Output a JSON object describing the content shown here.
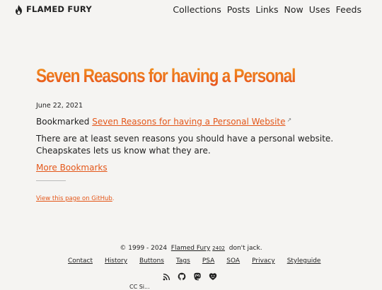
{
  "brand": {
    "name": "FLAMED FURY",
    "logo_icon": "flame-icon"
  },
  "nav": {
    "items": [
      {
        "label": "Collections"
      },
      {
        "label": "Posts"
      },
      {
        "label": "Links"
      },
      {
        "label": "Now"
      },
      {
        "label": "Uses"
      },
      {
        "label": "Feeds"
      }
    ]
  },
  "post": {
    "title": "Seven Reasons for having a Personal Website",
    "date": "June 22, 2021",
    "bookmarked_prefix": "Bookmarked",
    "bookmark_link": "Seven Reasons for having a Personal Website",
    "external_icon": "external-link-icon",
    "description": "There are at least seven reasons you should have a personal website. Cheapskates lets us know what they are.",
    "more_link": "More Bookmarks",
    "github_link": "View this page on GitHub",
    "github_suffix": "."
  },
  "footer": {
    "copyright": "© 1999 - 2024",
    "site_name": "Flamed Fury",
    "version": "2402",
    "tagline": "don't jack.",
    "links": [
      {
        "label": "Contact"
      },
      {
        "label": "History"
      },
      {
        "label": "Buttons"
      },
      {
        "label": "Tags"
      },
      {
        "label": "PSA"
      },
      {
        "label": "SOA"
      },
      {
        "label": "Privacy"
      },
      {
        "label": "Styleguide"
      }
    ],
    "social_icons": [
      "rss-icon",
      "github-icon",
      "mastodon-icon",
      "omg-lol-icon"
    ],
    "cutoff_text": "CC Si..."
  },
  "colors": {
    "accent": "#e4571a",
    "title_gradient_top": "#f29e1c",
    "title_gradient_bottom": "#e4421c",
    "background": "#f5f4f2"
  }
}
